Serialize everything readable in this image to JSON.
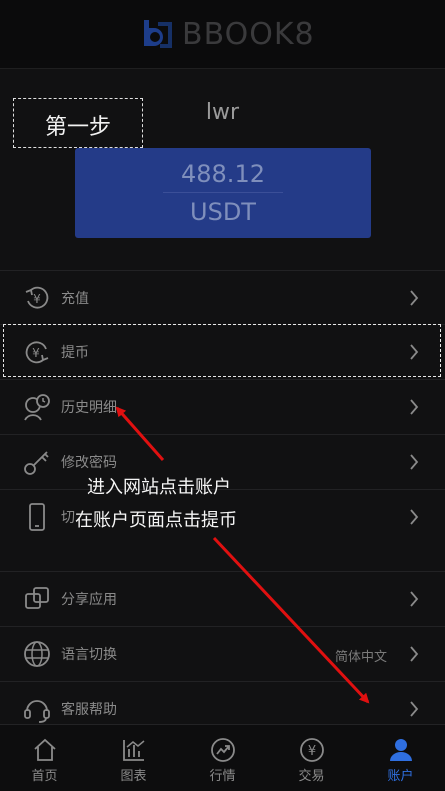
{
  "header": {
    "brand": "BBOOK8"
  },
  "account": {
    "username": "lwr",
    "balance": "488.12",
    "currency": "USDT"
  },
  "menu": {
    "recharge": "充值",
    "withdraw": "提币",
    "history": "历史明细",
    "change_password": "修改密码",
    "switch_label": "切",
    "share_app": "分享应用",
    "language": "语言切换",
    "language_value": "简体中文",
    "support": "客服帮助"
  },
  "annotations": {
    "step": "第一步",
    "instruction_line1": "进入网站点击账户",
    "instruction_line2": "在账户页面点击提币"
  },
  "tabs": [
    {
      "label": "首页"
    },
    {
      "label": "图表"
    },
    {
      "label": "行情"
    },
    {
      "label": "交易"
    },
    {
      "label": "账户"
    }
  ],
  "colors": {
    "accent": "#2f6fe0",
    "card": "#243b88",
    "arrow": "#e01010"
  }
}
